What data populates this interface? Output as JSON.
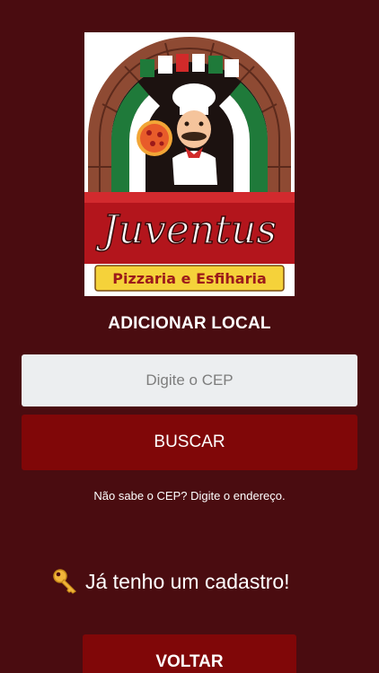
{
  "logo": {
    "brand": "Juventus",
    "tagline": "Pizzaria e Esfiharia"
  },
  "page": {
    "title": "ADICIONAR LOCAL"
  },
  "cep": {
    "placeholder": "Digite o CEP",
    "value": ""
  },
  "buttons": {
    "search": "BUSCAR",
    "back": "VOLTAR"
  },
  "links": {
    "address": "Não sabe o CEP? Digite o endereço.",
    "registered": "Já tenho um cadastro!"
  },
  "icons": {
    "registered_icon": "key-icon"
  },
  "colors": {
    "background": "#4a0c10",
    "button": "#800708",
    "input": "#eceef0",
    "text": "#ffffff"
  }
}
